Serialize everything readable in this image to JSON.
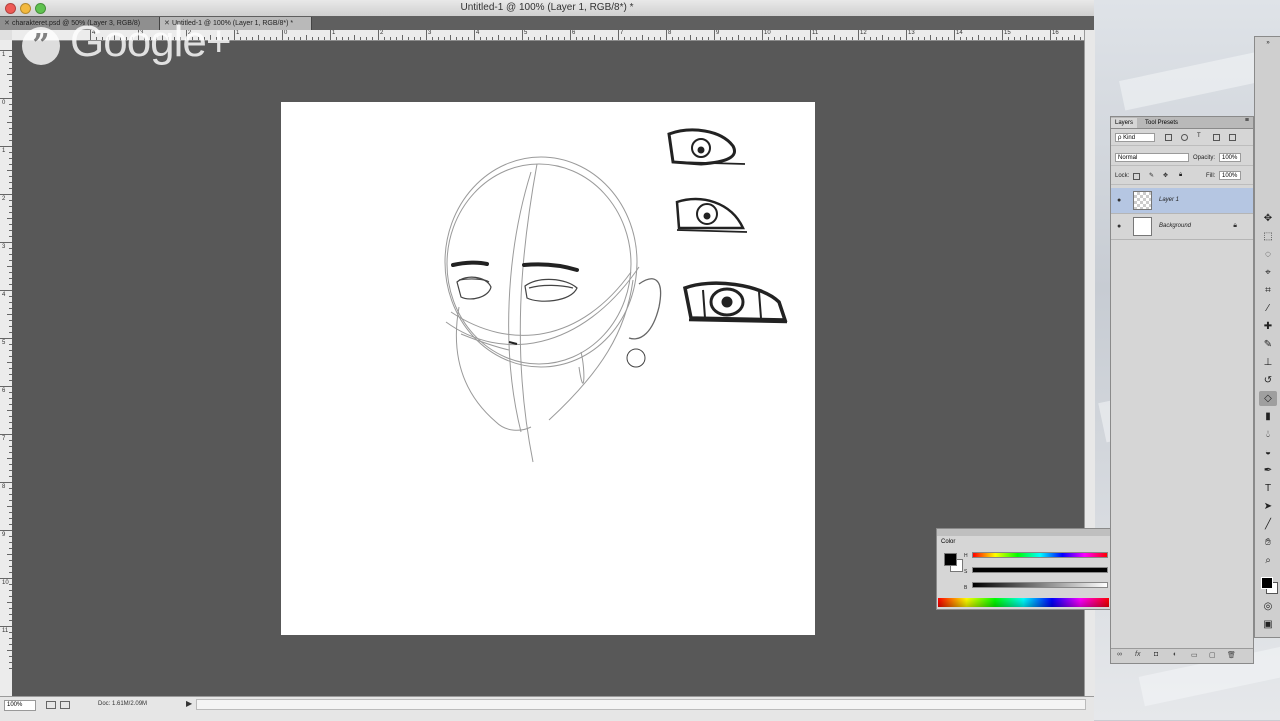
{
  "window": {
    "title": "Untitled-1 @ 100% (Layer 1, RGB/8*) *"
  },
  "document_tabs": [
    {
      "label": "charakteret.psd @ 50% (Layer 3, RGB/8)"
    },
    {
      "label": "Untitled-1 @ 100% (Layer 1, RGB/8*) *"
    }
  ],
  "ruler": {
    "top_numbers": [
      "4",
      "3",
      "2",
      "1",
      "0",
      "1",
      "2",
      "3",
      "4",
      "5",
      "6",
      "7",
      "8",
      "9",
      "10",
      "11",
      "12",
      "13",
      "14",
      "15",
      "16"
    ],
    "left_numbers": [
      "1",
      "0",
      "1",
      "2",
      "3",
      "4",
      "5",
      "6",
      "7",
      "8",
      "9",
      "10",
      "11"
    ]
  },
  "watermark": {
    "glyph": "”",
    "text": "Google+"
  },
  "status": {
    "zoom": "100%",
    "doc_size": "Doc: 1.61M/2.09M",
    "arrow": "▶"
  },
  "layers_panel": {
    "tabs": [
      "Layers",
      "Tool Presets"
    ],
    "filter_kind": "ρ Kind",
    "blend_mode": "Normal",
    "opacity_label": "Opacity:",
    "opacity_value": "100%",
    "lock_label": "Lock:",
    "fill_label": "Fill:",
    "fill_value": "100%",
    "layers": [
      {
        "name": "Layer 1",
        "selected": true,
        "visible": true
      },
      {
        "name": "Background",
        "selected": false,
        "visible": true,
        "locked": true
      }
    ],
    "footer_icons": [
      "link-icon",
      "fx-icon",
      "mask-icon",
      "adjustment-icon",
      "group-icon",
      "new-layer-icon",
      "trash-icon"
    ]
  },
  "color_panel": {
    "tab": "Color",
    "foreground": "#000000",
    "background": "#ffffff",
    "sliders": [
      {
        "label": "H",
        "value": 0
      },
      {
        "label": "S",
        "value": 0
      },
      {
        "label": "B",
        "value": 0
      }
    ]
  },
  "tools_panel": {
    "icons": [
      "move-tool-icon",
      "marquee-tool-icon",
      "lasso-tool-icon",
      "quick-select-tool-icon",
      "crop-tool-icon",
      "eyedropper-tool-icon",
      "healing-brush-tool-icon",
      "brush-tool-icon",
      "clone-stamp-tool-icon",
      "history-brush-tool-icon",
      "eraser-tool-icon",
      "gradient-tool-icon",
      "blur-tool-icon",
      "dodge-tool-icon",
      "pen-tool-icon",
      "type-tool-icon",
      "path-select-tool-icon",
      "line-tool-icon",
      "hand-tool-icon",
      "zoom-tool-icon"
    ],
    "active": "eraser-tool-icon"
  },
  "colors": {
    "canvas": "#ffffff",
    "pasteboard": "#585858",
    "selected_layer": "#b5c6e2"
  }
}
